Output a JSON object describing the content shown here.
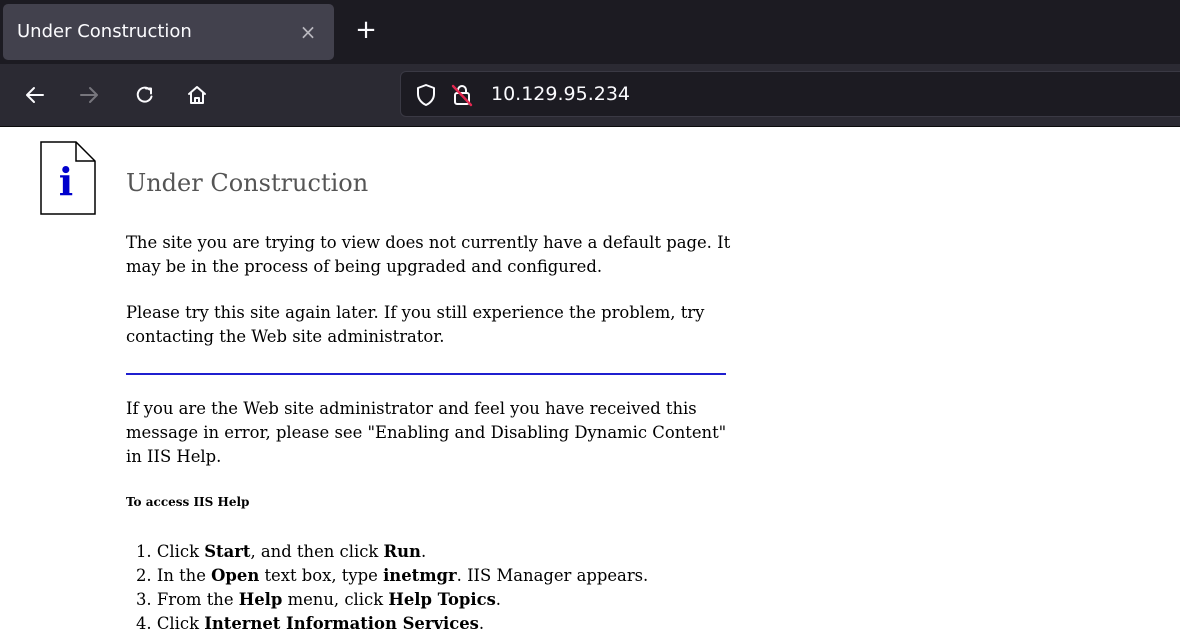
{
  "browser": {
    "tab_title": "Under Construction",
    "tab_close_glyph": "×",
    "new_tab_glyph": "+",
    "url": "10.129.95.234",
    "icons": [
      "back-arrow-icon",
      "forward-arrow-icon",
      "reload-icon",
      "home-icon",
      "shield-icon",
      "insecure-lock-icon",
      "tab-close-icon",
      "new-tab-plus-icon"
    ],
    "colors": {
      "tabbar_bg": "#1c1b22",
      "active_tab_bg": "#42414d",
      "navbar_bg": "#2b2a33",
      "text": "#fbfbfe",
      "insecure_slash": "#e22850"
    }
  },
  "page": {
    "icon": "info-document-icon",
    "icon_glyph": "i",
    "title": "Under Construction",
    "para1": "The site you are trying to view does not currently have a default page. It may be in the process of being upgraded and configured.",
    "para2": "Please try this site again later. If you still experience the problem, try contacting the Web site administrator.",
    "para3": "If you are the Web site administrator and feel you have received this message in error, please see \"Enabling and Disabling Dynamic Content\" in IIS Help.",
    "help_heading": "To access IIS Help",
    "steps": [
      {
        "n": "1. ",
        "a": "Click ",
        "b1": "Start",
        "c": ", and then click ",
        "b2": "Run",
        "d": "."
      },
      {
        "n": "2. ",
        "a": "In the ",
        "b1": "Open",
        "c": " text box, type ",
        "b2": "inetmgr",
        "d": ". IIS Manager appears."
      },
      {
        "n": "3. ",
        "a": "From the ",
        "b1": "Help",
        "c": " menu, click ",
        "b2": "Help Topics",
        "d": "."
      },
      {
        "n": "4. ",
        "a": "Click ",
        "b1": "Internet Information Services",
        "c": "",
        "b2": "",
        "d": "."
      }
    ],
    "colors": {
      "rule": "#1f1fcf",
      "icon_letter": "#0000cc",
      "heading": "#555555"
    }
  }
}
